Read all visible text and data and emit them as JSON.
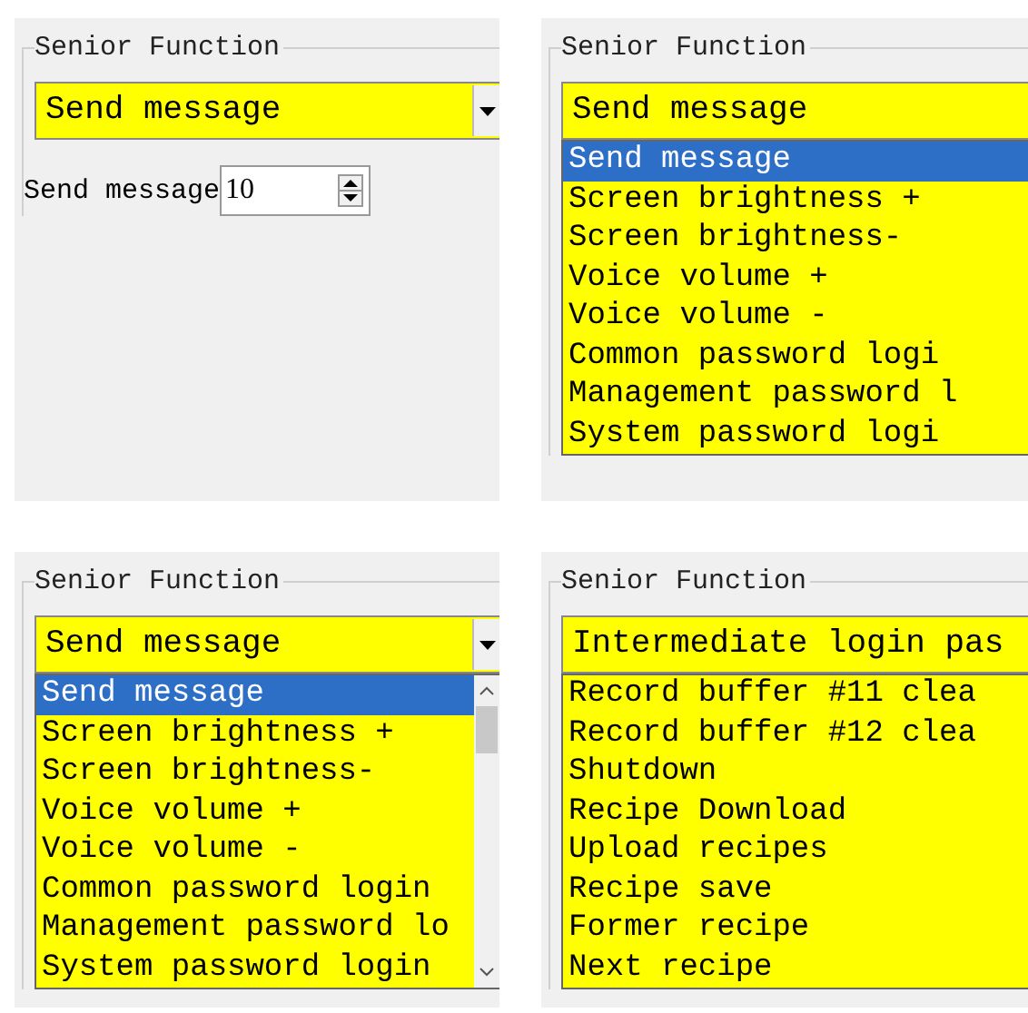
{
  "panels": [
    {
      "title": "Senior Function",
      "combo": {
        "value": "Send message",
        "arrow_button": true
      },
      "spinner": {
        "label": "Send message",
        "value": "10"
      }
    },
    {
      "title": "Senior Function",
      "combo": {
        "value": "Send message"
      },
      "list": {
        "items": [
          {
            "label": "Send message",
            "selected": true
          },
          {
            "label": "Screen brightness +",
            "selected": false
          },
          {
            "label": "Screen brightness-",
            "selected": false
          },
          {
            "label": "Voice volume +",
            "selected": false
          },
          {
            "label": "Voice volume -",
            "selected": false
          },
          {
            "label": "Common password logi",
            "selected": false
          },
          {
            "label": "Management password l",
            "selected": false
          },
          {
            "label": "System password logi",
            "selected": false
          }
        ]
      }
    },
    {
      "title": "Senior Function",
      "combo": {
        "value": "Send message",
        "arrow_button": true
      },
      "list": {
        "scrollbar": true,
        "items": [
          {
            "label": "Send message",
            "selected": true
          },
          {
            "label": "Screen brightness +",
            "selected": false
          },
          {
            "label": "Screen brightness-",
            "selected": false
          },
          {
            "label": "Voice volume +",
            "selected": false
          },
          {
            "label": "Voice volume -",
            "selected": false
          },
          {
            "label": "Common password login",
            "selected": false
          },
          {
            "label": "Management password lo",
            "selected": false
          },
          {
            "label": "System password login",
            "selected": false
          }
        ]
      }
    },
    {
      "title": "Senior Function",
      "combo": {
        "value": "Intermediate login pas"
      },
      "list": {
        "items": [
          {
            "label": "Record buffer #11 clea",
            "selected": false
          },
          {
            "label": "Record buffer #12 clea",
            "selected": false
          },
          {
            "label": "Shutdown",
            "selected": false
          },
          {
            "label": "Recipe Download",
            "selected": false
          },
          {
            "label": "Upload recipes",
            "selected": false
          },
          {
            "label": "Recipe save",
            "selected": false
          },
          {
            "label": "Former recipe",
            "selected": false
          },
          {
            "label": "Next recipe",
            "selected": false
          }
        ]
      }
    }
  ]
}
